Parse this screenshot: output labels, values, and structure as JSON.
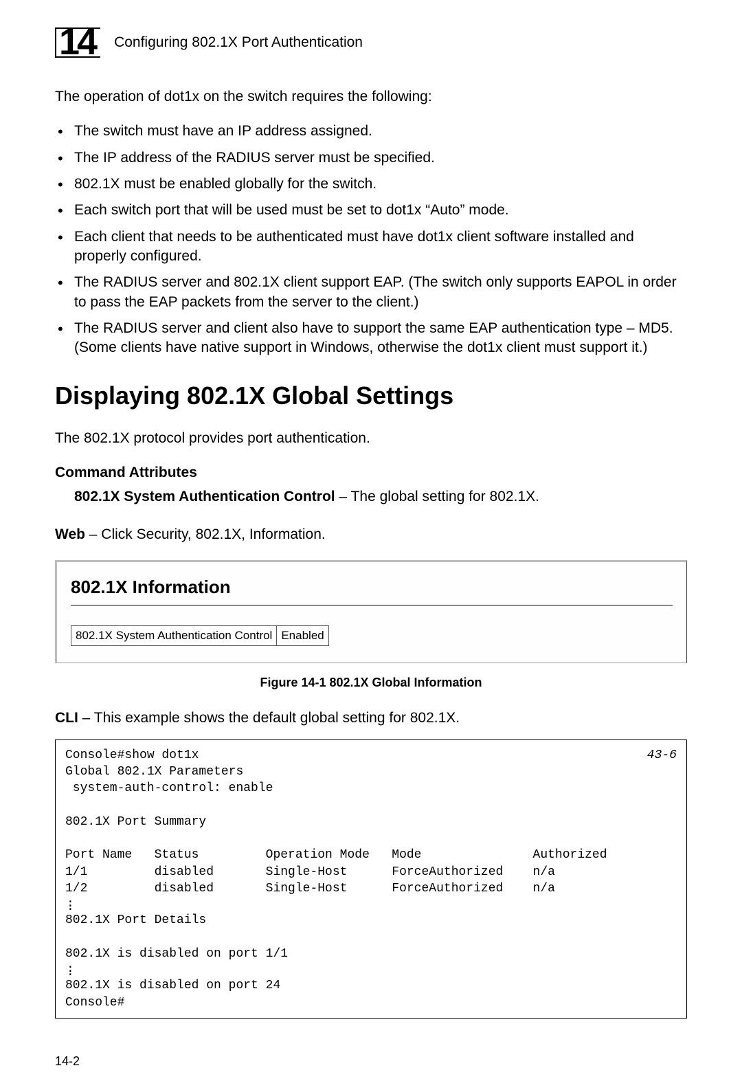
{
  "header": {
    "chapter": "14",
    "title": "Configuring 802.1X Port Authentication"
  },
  "intro": "The operation of dot1x on the switch requires the following:",
  "bullets": [
    "The switch must have an IP address assigned.",
    "The IP address of the RADIUS server must be specified.",
    "802.1X must be enabled globally for the switch.",
    "Each switch port that will be used must be set to dot1x “Auto” mode.",
    "Each client that needs to be authenticated must have dot1x client software installed and properly configured.",
    "The RADIUS server and 802.1X client support EAP. (The switch only supports EAPOL in order to pass the EAP packets from the server to the client.)",
    "The RADIUS server and client also have to support the same EAP authentication type – MD5. (Some clients have native support in Windows, otherwise the dot1x client must support it.)"
  ],
  "section_title": "Displaying 802.1X Global Settings",
  "sub_intro": "The 802.1X protocol provides port authentication.",
  "cmd_attr_title": "Command Attributes",
  "attr_bold": "802.1X System Authentication Control",
  "attr_rest": " – The global setting for 802.1X.",
  "web_lead": "Web",
  "web_rest": " – Click Security, 802.1X, Information.",
  "info_panel": {
    "title": "802.1X Information",
    "label": "802.1X System Authentication Control",
    "value": "Enabled"
  },
  "figure_caption": "Figure 14-1  802.1X Global Information",
  "cli_lead": "CLI",
  "cli_rest": " – This example shows the default global setting for 802.1X.",
  "cli_output": {
    "ref": "43-6",
    "line1": "Console#show dot1x",
    "line2": "Global 802.1X Parameters",
    "line3": " system-auth-control: enable",
    "blank1": "",
    "line4": "802.1X Port Summary",
    "blank2": "",
    "headerrow": "Port Name   Status         Operation Mode   Mode               Authorized",
    "row1": "1/1         disabled       Single-Host      ForceAuthorized    n/a",
    "row2": "1/2         disabled       Single-Host      ForceAuthorized    n/a",
    "line5": "802.1X Port Details",
    "blank3": "",
    "line6": "802.1X is disabled on port 1/1",
    "line7": "802.1X is disabled on port 24",
    "line8": "Console#"
  },
  "page_num": "14-2"
}
